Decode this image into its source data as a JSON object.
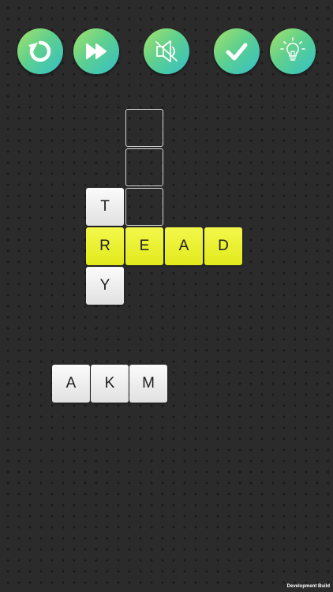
{
  "toolbar": {
    "buttons": [
      {
        "id": "restart",
        "icon": "restart-icon"
      },
      {
        "id": "skip",
        "icon": "fast-forward-icon"
      },
      {
        "id": "sound",
        "icon": "speaker-muted-icon"
      },
      {
        "id": "check",
        "icon": "checkmark-icon"
      },
      {
        "id": "hint",
        "icon": "lightbulb-icon"
      }
    ],
    "gradient": [
      "#a6e36a",
      "#5fd08d",
      "#31c0c9"
    ]
  },
  "board": {
    "across_word": [
      "R",
      "E",
      "A",
      "D"
    ],
    "down_word": [
      "T",
      "R",
      "Y"
    ],
    "empty_slots": 3
  },
  "rack": {
    "letters": [
      "A",
      "K",
      "M"
    ]
  },
  "colors": {
    "background": "#2b2b2b",
    "highlight_tile": "#e8ef2a",
    "tile": "#f0f0f0"
  },
  "footer": {
    "build_label": "Development Build"
  }
}
